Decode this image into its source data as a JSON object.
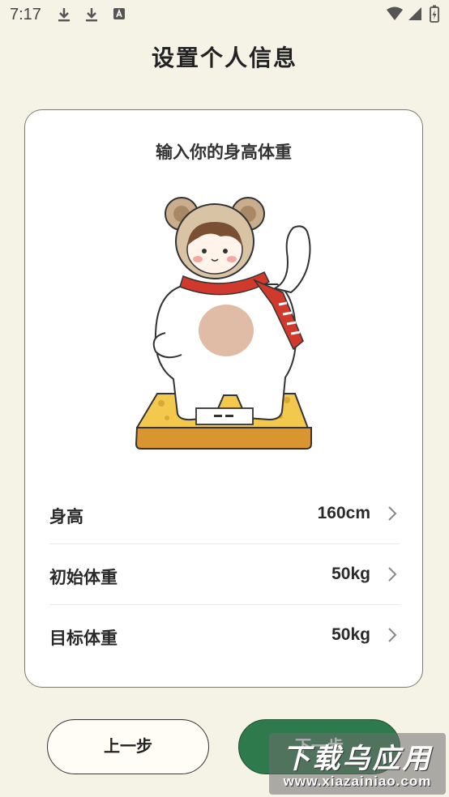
{
  "status_bar": {
    "time": "7:17"
  },
  "page": {
    "title": "设置个人信息"
  },
  "card": {
    "title": "输入你的身高体重",
    "rows": [
      {
        "label": "身高",
        "value": "160cm"
      },
      {
        "label": "初始体重",
        "value": "50kg"
      },
      {
        "label": "目标体重",
        "value": "50kg"
      }
    ]
  },
  "buttons": {
    "prev": "上一步",
    "next": "下一步"
  },
  "watermark": {
    "main": "下载乌应用",
    "sub": "www.xiazainiao.com"
  },
  "colors": {
    "background": "#f5f2e6",
    "primary_green": "#2e7a4c",
    "scarf_red": "#d0392b",
    "scale_yellow": "#f2c94c"
  }
}
